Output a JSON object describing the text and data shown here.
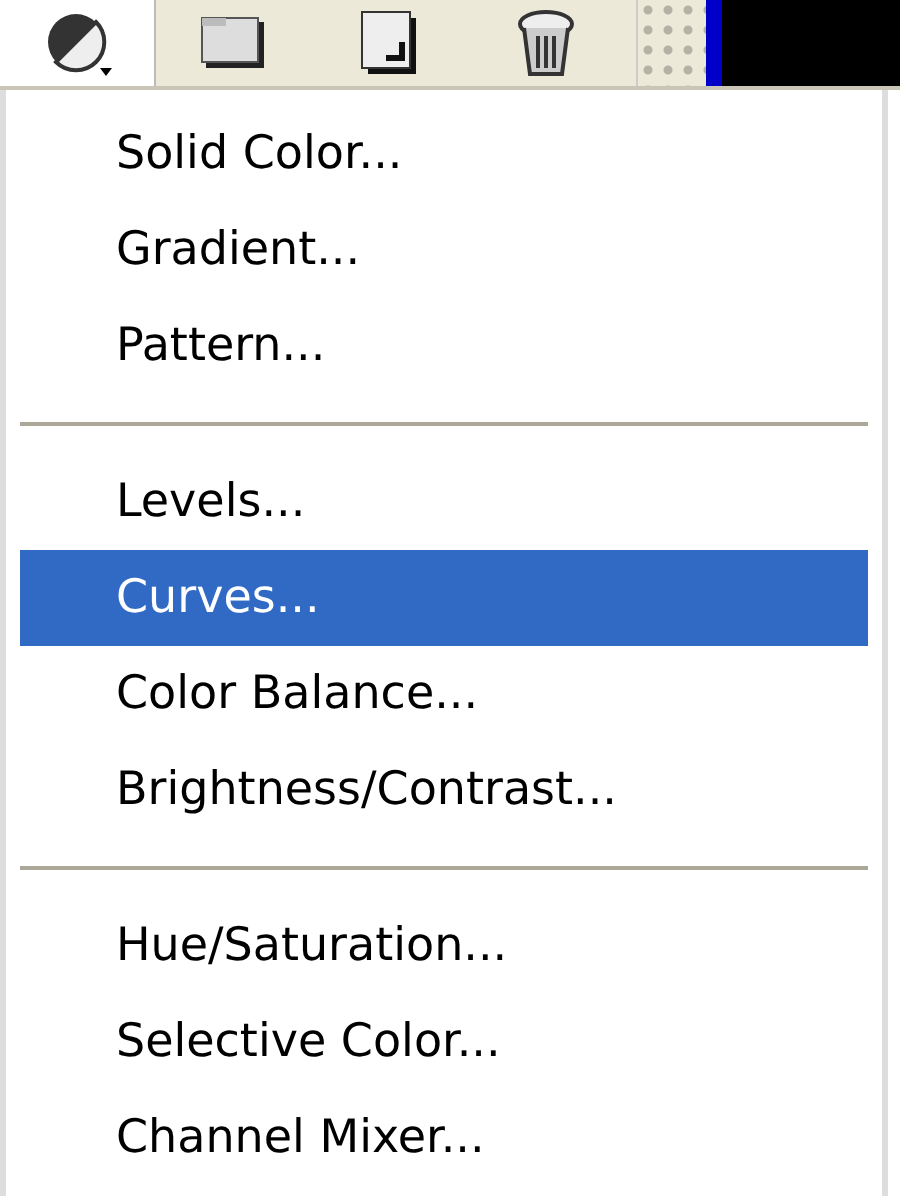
{
  "toolbar": {
    "buttons": [
      {
        "selected": true
      },
      {
        "selected": false
      },
      {
        "selected": false
      },
      {
        "selected": false
      }
    ]
  },
  "menu": {
    "items": [
      {
        "kind": "item",
        "label": "Solid Color...",
        "selected": false
      },
      {
        "kind": "item",
        "label": "Gradient...",
        "selected": false
      },
      {
        "kind": "item",
        "label": "Pattern...",
        "selected": false
      },
      {
        "kind": "separator"
      },
      {
        "kind": "item",
        "label": "Levels...",
        "selected": false
      },
      {
        "kind": "item",
        "label": "Curves...",
        "selected": true
      },
      {
        "kind": "item",
        "label": "Color Balance...",
        "selected": false
      },
      {
        "kind": "item",
        "label": "Brightness/Contrast...",
        "selected": false
      },
      {
        "kind": "separator"
      },
      {
        "kind": "item",
        "label": "Hue/Saturation...",
        "selected": false
      },
      {
        "kind": "item",
        "label": "Selective Color...",
        "selected": false
      },
      {
        "kind": "item",
        "label": "Channel Mixer...",
        "selected": false
      }
    ]
  }
}
